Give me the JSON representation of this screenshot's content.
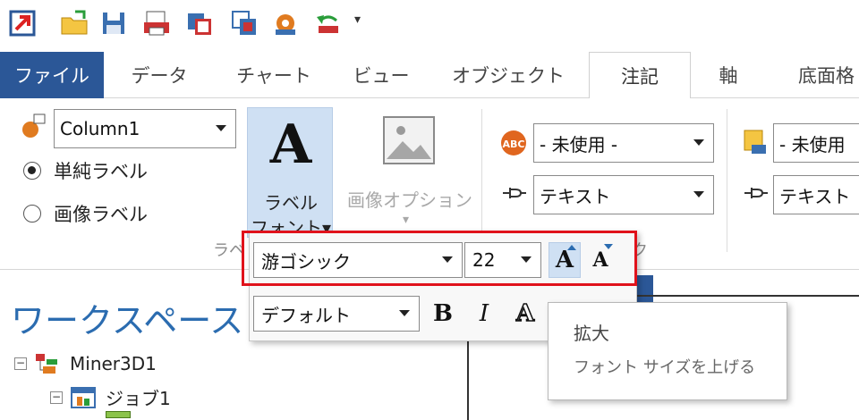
{
  "tabs": {
    "file": "ファイル",
    "data": "データ",
    "chart": "チャート",
    "view": "ビュー",
    "object": "オブジェクト",
    "annotation": "注記",
    "axis": "軸",
    "floor": "底面格"
  },
  "ribbon": {
    "column_combo_value": "Column1",
    "radio_simple_label": "単純ラベル",
    "radio_image_label": "画像ラベル",
    "label_font_line1": "ラベル",
    "label_font_line2": "フォント▾",
    "big_letter": "A",
    "image_option_label": "画像オプション",
    "image_option_arrow": "▾",
    "group_label_partial": "ラベ",
    "group_label_right_partial": "ク",
    "unused_combo_1": "- 未使用 -",
    "text_combo_1": "テキスト",
    "unused_combo_2": "- 未使用",
    "text_combo_2": "テキスト"
  },
  "popup": {
    "font_name": "游ゴシック",
    "font_size": "22",
    "grow_font": "A",
    "shrink_font": "A",
    "style_default": "デフォルト",
    "bold": "B",
    "italic": "I",
    "outline": "A"
  },
  "tooltip": {
    "title": "拡大",
    "description": "フォント サイズを上げる"
  },
  "workspace": {
    "title": "ワークスペース",
    "tree": [
      {
        "label": "Miner3D1",
        "toggle": "−"
      },
      {
        "label": "ジョブ1",
        "toggle": "−"
      }
    ]
  },
  "colors": {
    "file_tab": "#2b5797",
    "highlight": "#e0121b",
    "workspace_title": "#2b6cb0",
    "active_button": "#cfe0f3"
  }
}
